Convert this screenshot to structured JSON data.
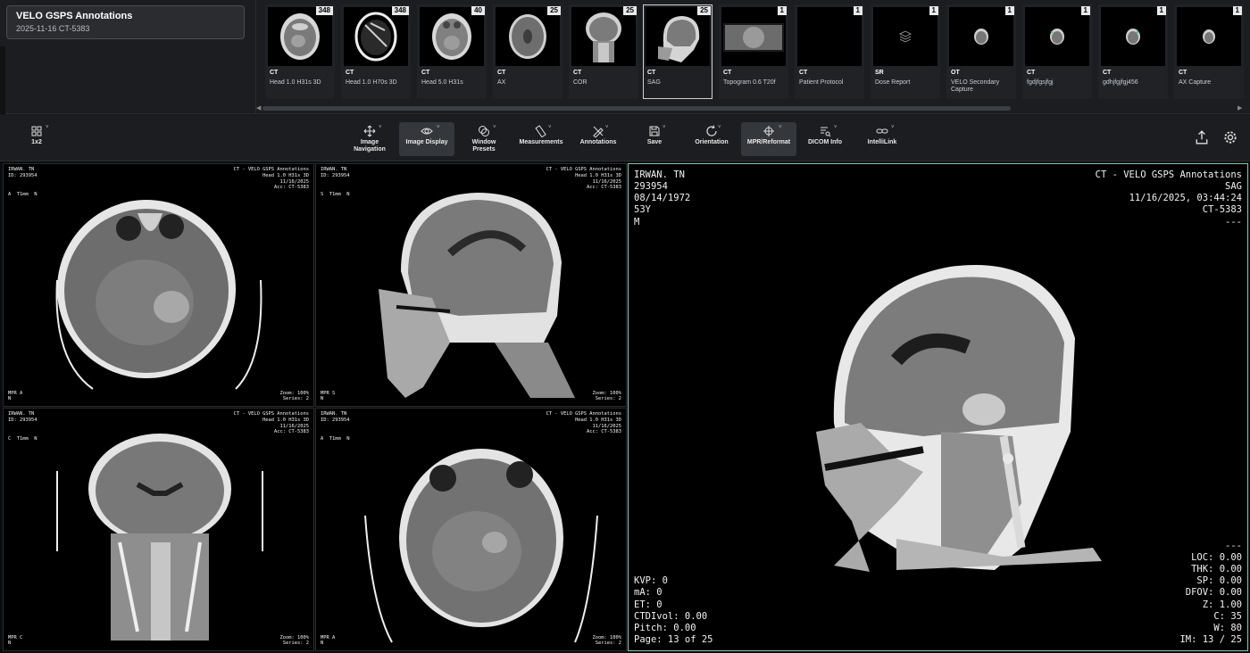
{
  "study": {
    "title": "VELO GSPS Annotations",
    "subtitle": "2025-11-16   CT-5383"
  },
  "series": [
    {
      "count": "348",
      "modality": "CT",
      "desc": "Head 1.0 H31s 3D",
      "icon": "axial-head-thumbnail"
    },
    {
      "count": "348",
      "modality": "CT",
      "desc": "Head 1.0 H70s 3D",
      "icon": "axial-bone-thumbnail"
    },
    {
      "count": "40",
      "modality": "CT",
      "desc": "Head 5.0 H31s",
      "icon": "axial-head-thumbnail"
    },
    {
      "count": "25",
      "modality": "CT",
      "desc": "AX",
      "icon": "axial-brain-thumbnail"
    },
    {
      "count": "25",
      "modality": "CT",
      "desc": "COR",
      "icon": "coronal-head-thumbnail"
    },
    {
      "count": "25",
      "modality": "CT",
      "desc": "SAG",
      "icon": "sagittal-head-thumbnail"
    },
    {
      "count": "1",
      "modality": "CT",
      "desc": "Topogram 0.6 T20f",
      "icon": "topogram-thumbnail"
    },
    {
      "count": "1",
      "modality": "CT",
      "desc": "Patient Protocol",
      "icon": "blank-thumbnail"
    },
    {
      "count": "1",
      "modality": "SR",
      "desc": "Dose Report",
      "icon": "layers-icon"
    },
    {
      "count": "1",
      "modality": "OT",
      "desc": "VELO Secondary Capture",
      "icon": "small-head-thumbnail"
    },
    {
      "count": "1",
      "modality": "CT",
      "desc": "fgdjfgsjfgj",
      "icon": "small-head-thumbnail"
    },
    {
      "count": "1",
      "modality": "CT",
      "desc": "gdhjfgjfgj456",
      "icon": "small-head-thumbnail"
    },
    {
      "count": "1",
      "modality": "CT",
      "desc": "AX Capture",
      "icon": "small-head-thumbnail"
    }
  ],
  "toolbar": {
    "layout": "1x2",
    "tools": [
      {
        "label": "Image\nNavigation",
        "icon": "move-icon"
      },
      {
        "label": "Image Display",
        "icon": "eye-icon"
      },
      {
        "label": "Window\nPresets",
        "icon": "contrast-icon"
      },
      {
        "label": "Measurements",
        "icon": "ruler-icon"
      },
      {
        "label": "Annotations",
        "icon": "pencil-ruler-icon"
      },
      {
        "label": "Save",
        "icon": "save-icon"
      },
      {
        "label": "Orientation",
        "icon": "rotate-icon"
      },
      {
        "label": "MPR/Reformat",
        "icon": "mpr-icon"
      },
      {
        "label": "DICOM Info",
        "icon": "dicom-info-icon"
      },
      {
        "label": "IntelliLink",
        "icon": "link-icon"
      }
    ],
    "right_icons": [
      "upload-icon",
      "settings-icon"
    ]
  },
  "viewports": [
    {
      "tl": "IRWAN. TN\nID: 293954",
      "tr": "CT - VELO GSPS Annotations\nHead 1.0 H31s 3D\n11/16/2025\nAcc: CT-5383",
      "ml": "A  T1mm  N",
      "bl": "MPR A\nN",
      "br": "Zoom: 100%\nSeries: 2"
    },
    {
      "tl": "IRWAN. TN\nID: 293954",
      "tr": "CT - VELO GSPS Annotations\nHead 1.0 H31s 3D\n11/16/2025\nAcc: CT-5383",
      "ml": "S  T1mm  N",
      "bl": "MPR S\nN",
      "br": "Zoom: 100%\nSeries: 2"
    },
    {
      "tl": "IRWAN. TN\nID: 293954",
      "tr": "CT - VELO GSPS Annotations\nHead 1.0 H31s 3D\n11/16/2025\nAcc: CT-5383",
      "ml": "C  T1mm  N",
      "bl": "MPR C\nN",
      "br": "Zoom: 100%\nSeries: 2"
    },
    {
      "tl": "IRWAN. TN\nID: 293954",
      "tr": "CT - VELO GSPS Annotations\nHead 1.0 H31s 3D\n11/16/2025\nAcc: CT-5383",
      "ml": "A  T1mm  N",
      "bl": "MPR A\nN",
      "br": "Zoom: 100%\nSeries: 2"
    }
  ],
  "main_viewport": {
    "tl": "IRWAN. TN\n293954\n08/14/1972\n53Y\nM",
    "tr": "CT - VELO GSPS Annotations\nSAG\n11/16/2025, 03:44:24\nCT-5383\n---",
    "bl": "KVP: 0\nmA: 0\nET: 0\nCTDIvol: 0.00\nPitch: 0.00\nPage: 13 of 25",
    "br": "---\nLOC: 0.00\nTHK: 0.00\nSP: 0.00\nDFOV: 0.00\nZ: 1.00\nC: 35\nW: 80\nIM: 13 / 25"
  }
}
